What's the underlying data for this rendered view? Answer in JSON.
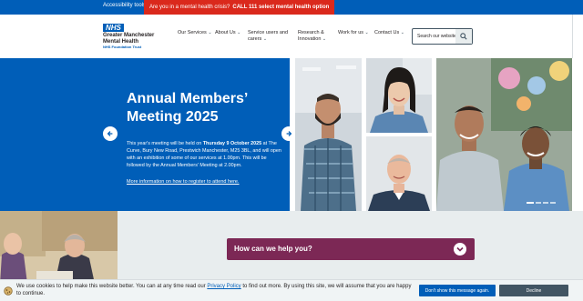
{
  "topbar": {
    "accessibility": "Accessibility tools",
    "crisis_text": "Are you in a mental health crisis?",
    "crisis_cta": "CALL 111 select mental health option"
  },
  "logo": {
    "badge": "NHS",
    "line1": "Greater Manchester",
    "line2": "Mental Health",
    "line3": "NHS Foundation Trust"
  },
  "nav": {
    "items": [
      {
        "line1": "Our Services",
        "line2": ""
      },
      {
        "line1": "About Us",
        "line2": ""
      },
      {
        "line1": "Service users and",
        "line2": "carers"
      },
      {
        "line1": "Research &",
        "line2": "Innovation"
      },
      {
        "line1": "Work for us",
        "line2": ""
      },
      {
        "line1": "Contact Us",
        "line2": ""
      }
    ]
  },
  "search": {
    "placeholder": "Search our website",
    "icon": "search-icon"
  },
  "hero": {
    "title": "Annual Members’ Meeting 2025",
    "body_pre": "This year's meeting will be held on ",
    "body_date": "Thursday 9 October 2025",
    "body_post": " at The Curve, Bury New Road, Prestwich Manchester, M25 3BL, and will open with an exhibition of some of our services at 1.00pm. This will be followed by the Annual Members' Meeting at 2.00pm.",
    "link": "More information on how to register to attend here.",
    "slides": 4,
    "active_slide": 1
  },
  "help": {
    "label": "How can we help you?"
  },
  "cookie": {
    "text_pre": "We use cookies to help make this website better. You can at any time read our ",
    "link": "Privacy Policy",
    "text_post": " to find out more. By using this site, we will assume that you are happy to continue.",
    "dont_show": "Don't show this message again.",
    "decline": "Decline"
  },
  "colors": {
    "nhs_blue": "#005eb8",
    "crisis_red": "#da291c",
    "help_plum": "#7c2855",
    "grey_bg": "#e8edee"
  }
}
